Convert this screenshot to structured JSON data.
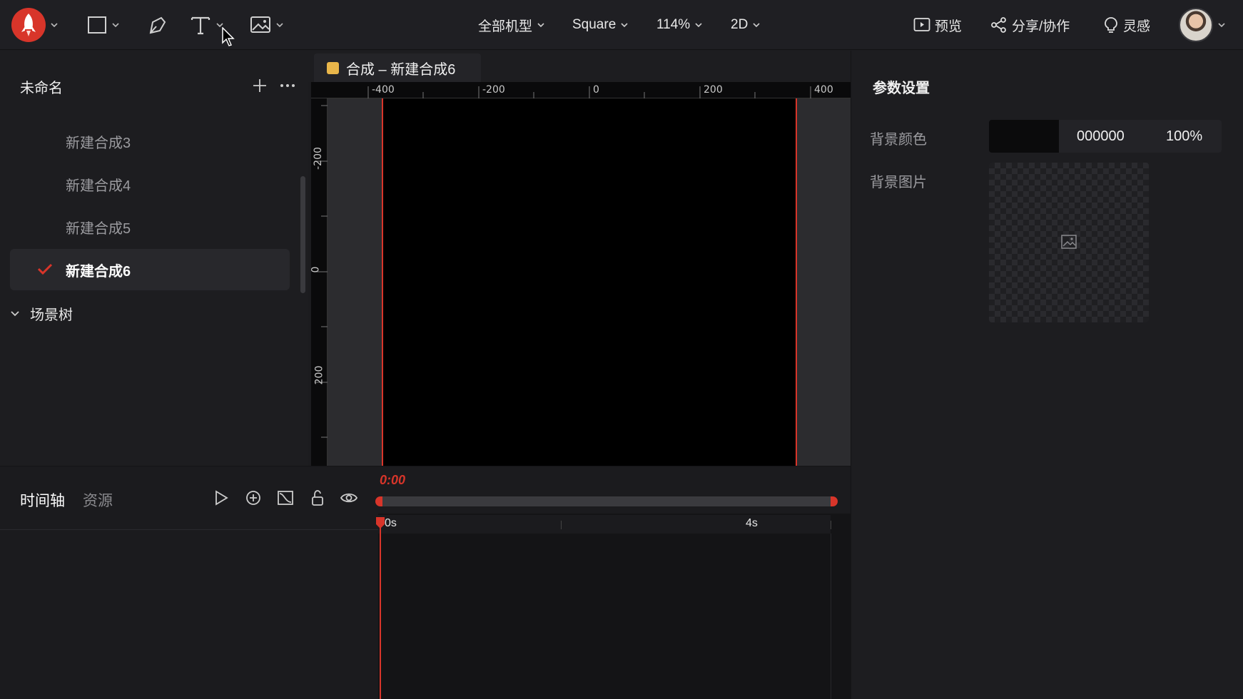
{
  "toolbar": {
    "device_menu": "全部机型",
    "size_menu": "Square",
    "zoom_menu": "114%",
    "mode_menu": "2D",
    "preview_label": "预览",
    "share_label": "分享/协作",
    "inspire_label": "灵感"
  },
  "left_panel": {
    "project_title": "未命名",
    "compositions": [
      {
        "label": "新建合成3",
        "active": false
      },
      {
        "label": "新建合成4",
        "active": false
      },
      {
        "label": "新建合成5",
        "active": false
      },
      {
        "label": "新建合成6",
        "active": true
      }
    ],
    "scene_tree_label": "场景树"
  },
  "canvas": {
    "tab_label": "合成 – 新建合成6",
    "ruler_top_labels": [
      "-400",
      "-200",
      "0",
      "200",
      "400"
    ],
    "ruler_left_labels": [
      "-200",
      "0",
      "200"
    ]
  },
  "right_panel": {
    "title": "参数设置",
    "bg_color_label": "背景颜色",
    "bg_color_hex": "000000",
    "bg_color_opacity": "100%",
    "bg_image_label": "背景图片"
  },
  "timeline": {
    "tab_timeline": "时间轴",
    "tab_assets": "资源",
    "current_time": "0:00",
    "mark_start": "0s",
    "mark_4s": "4s"
  },
  "colors": {
    "accent": "#d8352a",
    "tab_dot": "#e9b64a"
  }
}
